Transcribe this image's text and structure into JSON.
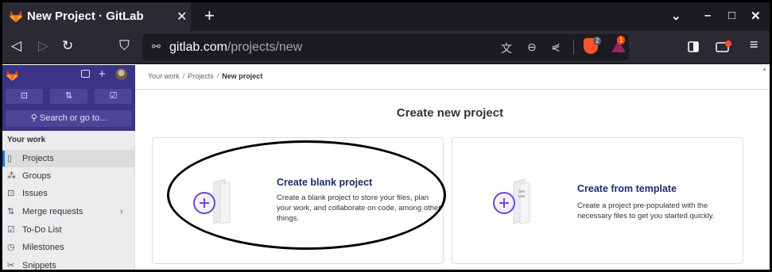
{
  "browser": {
    "tab_title": "New Project · GitLab",
    "close_glyph": "✕",
    "newtab_glyph": "+",
    "window_controls": [
      "⌄",
      "–",
      "□",
      "✕"
    ],
    "nav_buttons": [
      "◁",
      "▷",
      "↻",
      "⛉"
    ],
    "url_host": "gitlab.com",
    "url_path": "/projects/new",
    "url_icons": [
      "translate-icon",
      "zoom-out-icon",
      "share-icon"
    ],
    "brave_shield_count": "2",
    "rewards_count": "1",
    "accent_colors": {
      "tab_bg": "#2b2a33",
      "chrome_bg": "#1c1b22",
      "brave": "#fb542b",
      "rewards": "#9e1f63"
    }
  },
  "sidebar": {
    "top_buttons": [
      "⊡",
      "⇅",
      "☑"
    ],
    "search_label": "Search or go to...",
    "section_label": "Your work",
    "items": [
      {
        "label": "Projects",
        "icon": "▯",
        "active": true
      },
      {
        "label": "Groups",
        "icon": "⁂",
        "active": false
      },
      {
        "label": "Issues",
        "icon": "⊡",
        "active": false
      },
      {
        "label": "Merge requests",
        "icon": "⇅",
        "active": false,
        "chevron": "›"
      },
      {
        "label": "To-Do List",
        "icon": "☑",
        "active": false
      },
      {
        "label": "Milestones",
        "icon": "◷",
        "active": false
      },
      {
        "label": "Snippets",
        "icon": "✂",
        "active": false
      }
    ],
    "accent_colors": {
      "top_bg": "#3b3486",
      "active_bar": "#1f75cb"
    }
  },
  "breadcrumb": {
    "items": [
      "Your work",
      "Projects",
      "New project"
    ],
    "separator": "/"
  },
  "main": {
    "title": "Create new project",
    "cards": [
      {
        "title": "Create blank project",
        "description": "Create a blank project to store your files, plan your work, and collaborate on code, among other things."
      },
      {
        "title": "Create from template",
        "description": "Create a project pre-populated with the necessary files to get you started quickly."
      }
    ]
  }
}
